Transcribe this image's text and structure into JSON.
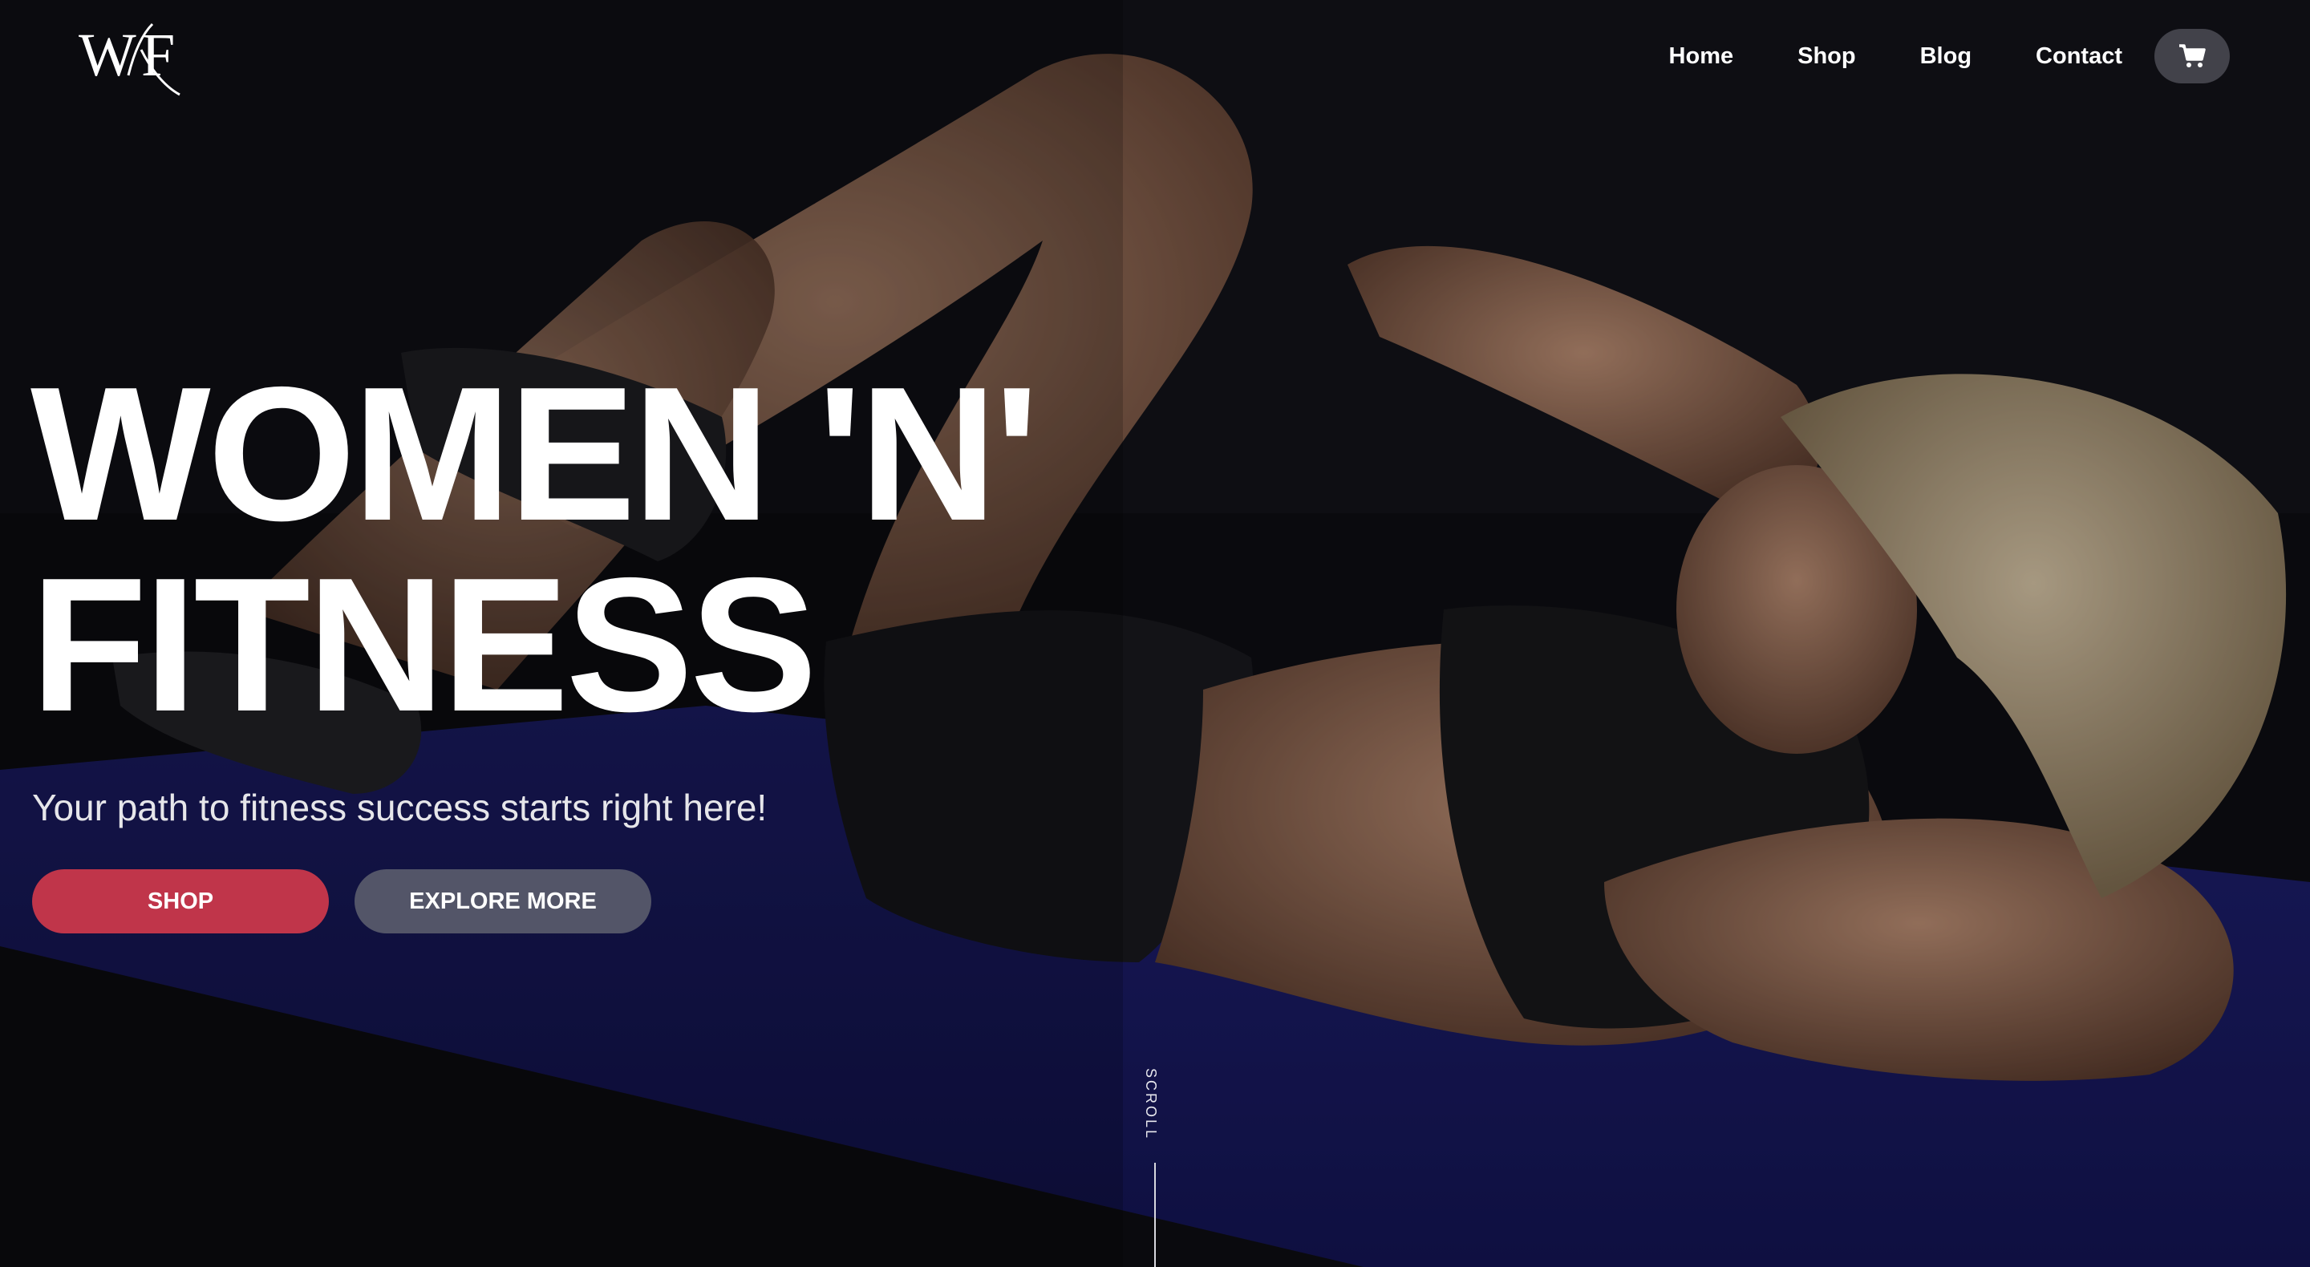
{
  "logo": {
    "icon": "wnf-logo-icon"
  },
  "nav": {
    "items": [
      {
        "label": "Home"
      },
      {
        "label": "Shop"
      },
      {
        "label": "Blog"
      },
      {
        "label": "Contact"
      }
    ],
    "cart_icon": "cart-icon"
  },
  "hero": {
    "headline_line1": "WOMEN 'N'",
    "headline_line2": "FITNESS",
    "subtitle": "Your path to fitness success starts right here!",
    "shop_button": "SHOP",
    "explore_button": "EXPLORE MORE",
    "scroll_label": "SCROLL"
  },
  "colors": {
    "accent": "#c0354a",
    "secondary_button": "#5f6270",
    "mat": "#1e1f6e",
    "text": "#ffffff"
  }
}
